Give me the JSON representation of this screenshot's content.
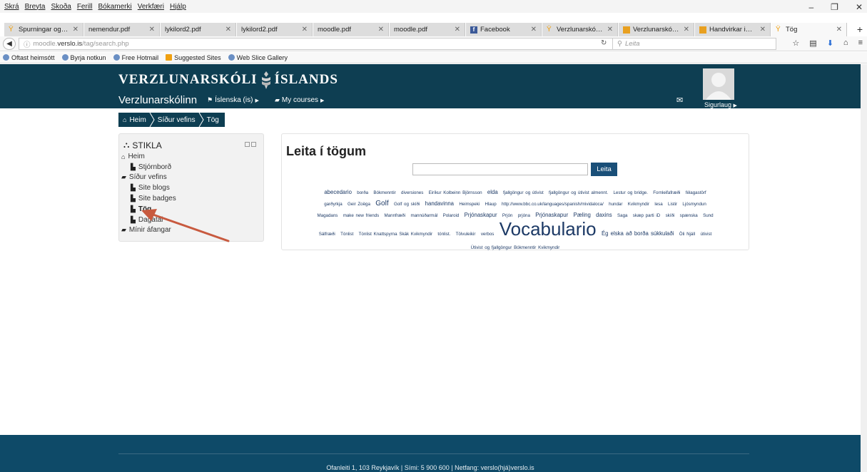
{
  "browser": {
    "menu": [
      "Skrá",
      "Breyta",
      "Skoða",
      "Ferill",
      "Bókamerki",
      "Verkfæri",
      "Hjálp"
    ],
    "window_controls": [
      "–",
      "❐",
      "✕"
    ],
    "tabs": [
      {
        "label": "Spurningar og svö...",
        "close": "✕",
        "active": false
      },
      {
        "label": "nemendur.pdf",
        "close": "✕",
        "active": false
      },
      {
        "label": "lykilord2.pdf",
        "close": "✕",
        "active": false
      },
      {
        "label": "lykilord2.pdf",
        "close": "✕",
        "active": false
      },
      {
        "label": "moodle.pdf",
        "close": "✕",
        "active": false
      },
      {
        "label": "moodle.pdf",
        "close": "✕",
        "active": false
      },
      {
        "label": "Facebook",
        "close": "✕",
        "active": false
      },
      {
        "label": "Verzlunarskóli Ísla...",
        "close": "✕",
        "active": false
      },
      {
        "label": "Verzlunarskóli Ísla...",
        "close": "✕",
        "active": false
      },
      {
        "label": "Handvirkar innrita...",
        "close": "✕",
        "active": false
      },
      {
        "label": "Tög",
        "close": "✕",
        "active": true
      }
    ],
    "new_tab": "+",
    "url_prefix": "moodle.",
    "url_host": "verslo.is",
    "url_path": "/tag/search.php",
    "search_placeholder": "Leita",
    "bookmarks": [
      "Oftast heimsótt",
      "Byrja notkun",
      "Free Hotmail",
      "Suggested Sites",
      "Web Slice Gallery"
    ]
  },
  "header": {
    "logo_left": "VERZLUNARSKÓLI",
    "logo_right": "ÍSLANDS",
    "site_name": "Verzlunarskólinn",
    "language": "Íslenska (is)",
    "courses": "My courses",
    "user": "Sigurlaug"
  },
  "breadcrumb": [
    "Heim",
    "Síður vefins",
    "Tög"
  ],
  "sidebar": {
    "title": "STIKLA",
    "items": [
      {
        "label": "Heim"
      },
      {
        "label": "Stjórnborð"
      },
      {
        "label": "Síður vefins"
      },
      {
        "label": "Site blogs"
      },
      {
        "label": "Site badges"
      },
      {
        "label": "Tög"
      },
      {
        "label": "Dagatal"
      },
      {
        "label": "Mínir áfangar"
      }
    ]
  },
  "main": {
    "title": "Leita í tögum",
    "search_button": "Leita",
    "tag_lines": [
      [
        {
          "t": "abecedario",
          "s": 2
        },
        {
          "t": "borða",
          "s": 1
        },
        {
          "t": "Bókmenntir",
          "s": 1
        },
        {
          "t": "diversiones",
          "s": 1
        },
        {
          "t": "Eiríkur Kolbeinn Björnsson",
          "s": 1
        },
        {
          "t": "elda",
          "s": 2
        },
        {
          "t": "fjallgöngur og útivist",
          "s": 1
        },
        {
          "t": "fjallgöngur og útivist almennt.",
          "s": 1
        },
        {
          "t": "Lestur og bridge.",
          "s": 1
        },
        {
          "t": "Fornleifafræði",
          "s": 1
        },
        {
          "t": "félagastörf",
          "s": 1
        }
      ],
      [
        {
          "t": "garðyrkja",
          "s": 1
        },
        {
          "t": "Geir Zoëga",
          "s": 1
        },
        {
          "t": "Golf",
          "s": 3
        },
        {
          "t": "Golf og skíði",
          "s": 1
        },
        {
          "t": "handavinna",
          "s": 2
        },
        {
          "t": "Heimspeki",
          "s": 1
        },
        {
          "t": "Hlaup",
          "s": 1
        },
        {
          "t": "http://www.bbc.co.uk/languages/spanish/mividaloca/",
          "s": 1
        },
        {
          "t": "hundar",
          "s": 1
        },
        {
          "t": "Kvikmyndir",
          "s": 1
        },
        {
          "t": "lesa",
          "s": 1
        },
        {
          "t": "Listir",
          "s": 1
        },
        {
          "t": "Ljósmyndun",
          "s": 1
        }
      ],
      [
        {
          "t": "Magadans",
          "s": 1
        },
        {
          "t": "make new friends",
          "s": 1
        },
        {
          "t": "Mannfræði",
          "s": 1
        },
        {
          "t": "mannúðarmál",
          "s": 1
        },
        {
          "t": "Polaroid",
          "s": 1
        },
        {
          "t": "Prjónaskapur",
          "s": 2
        },
        {
          "t": "Prjón",
          "s": 1
        },
        {
          "t": "prjóna",
          "s": 1
        },
        {
          "t": "Prjónaskapur",
          "s": 2
        },
        {
          "t": "Pæling",
          "s": 2
        },
        {
          "t": "daxins",
          "s": 2
        },
        {
          "t": "Saga",
          "s": 1
        },
        {
          "t": "skæp parti iD",
          "s": 1
        },
        {
          "t": "skíði",
          "s": 1
        },
        {
          "t": "spænska",
          "s": 1
        },
        {
          "t": "Sund",
          "s": 1
        }
      ],
      [
        {
          "t": "Sálfræði",
          "s": 1
        },
        {
          "t": "Tónlist",
          "s": 1
        },
        {
          "t": "Tónlist Knattspyrna Skák Kvikmyndir",
          "s": 1
        },
        {
          "t": "tónlist.",
          "s": 1
        },
        {
          "t": "Tölvuleikir",
          "s": 1
        },
        {
          "t": "verbos",
          "s": 1
        },
        {
          "t": "Vocabulario",
          "s": 4
        },
        {
          "t": "Ég elska að borða súkkulaði",
          "s": 2
        },
        {
          "t": "Öli Njáll",
          "s": 1
        },
        {
          "t": "útivist",
          "s": 1
        }
      ],
      [
        {
          "t": "Útivist og fjallgöngur Bókmenntir Kvikmyndir",
          "s": 1
        }
      ]
    ]
  },
  "footer": {
    "text": "Ofanleiti 1, 103 Reykjavík | Sími: 5 900 600 | Netfang: verslo(hjá)verslo.is"
  },
  "colors": {
    "header_bg": "#0e3e52",
    "footer_bg": "#0e4a68",
    "button_bg": "#1a4f78",
    "tag_text": "#1d3a66",
    "annotation_arrow": "#c85a3f"
  }
}
